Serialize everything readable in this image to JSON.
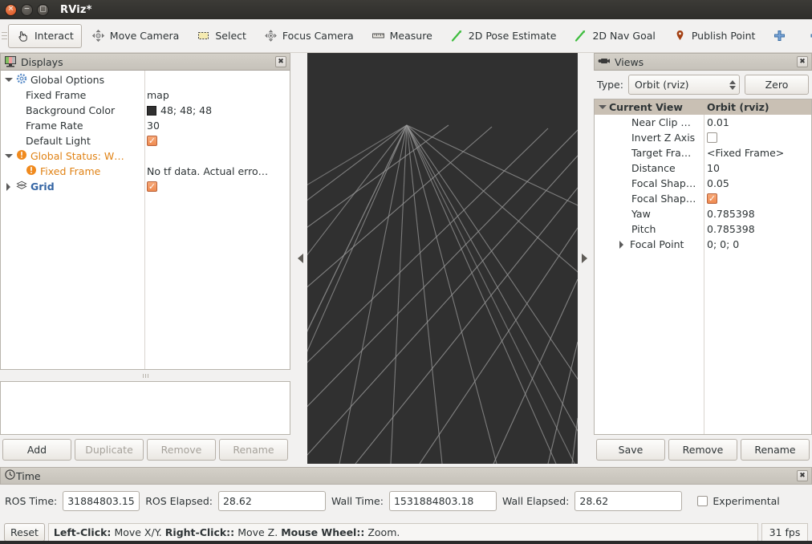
{
  "window": {
    "title": "RViz*",
    "buttons": {
      "close": "✕",
      "minimize": "−",
      "maximize": "□"
    }
  },
  "toolbar": {
    "items": [
      {
        "label": "Interact",
        "icon": "hand-cursor-icon",
        "checked": true
      },
      {
        "label": "Move Camera",
        "icon": "move-camera-icon",
        "checked": false
      },
      {
        "label": "Select",
        "icon": "select-rectangle-icon",
        "checked": false
      },
      {
        "label": "Focus Camera",
        "icon": "focus-camera-icon",
        "checked": false
      },
      {
        "label": "Measure",
        "icon": "ruler-icon",
        "checked": false
      },
      {
        "label": "2D Pose Estimate",
        "icon": "pose-arrow-icon",
        "checked": false
      },
      {
        "label": "2D Nav Goal",
        "icon": "nav-goal-arrow-icon",
        "checked": false
      },
      {
        "label": "Publish Point",
        "icon": "map-pin-icon",
        "checked": false
      },
      {
        "label": "",
        "icon": "plus-icon",
        "checked": false
      },
      {
        "label": "",
        "icon": "minus-icon",
        "checked": false
      }
    ]
  },
  "displays": {
    "title": "Displays",
    "icon": "displays-monitor-icon",
    "close_label": "✖",
    "rows": [
      {
        "name": "Global Options",
        "value": "",
        "indent": 0,
        "arrow": "down",
        "icon": "gear-icon",
        "style": "plain",
        "valueType": "none"
      },
      {
        "name": "Fixed Frame",
        "value": "map",
        "indent": 1,
        "arrow": "none",
        "icon": "",
        "style": "plain",
        "valueType": "text"
      },
      {
        "name": "Background Color",
        "value": "48; 48; 48",
        "indent": 1,
        "arrow": "none",
        "icon": "",
        "style": "plain",
        "valueType": "color",
        "swatch": "#303030"
      },
      {
        "name": "Frame Rate",
        "value": "30",
        "indent": 1,
        "arrow": "none",
        "icon": "",
        "style": "plain",
        "valueType": "text"
      },
      {
        "name": "Default Light",
        "value": "",
        "indent": 1,
        "arrow": "none",
        "icon": "",
        "style": "plain",
        "valueType": "checkbox-on"
      },
      {
        "name": "Global Status: W…",
        "value": "",
        "indent": 0,
        "arrow": "down",
        "icon": "warning-icon",
        "style": "warn",
        "valueType": "none"
      },
      {
        "name": "Fixed Frame",
        "value": "No tf data.  Actual erro…",
        "indent": 2,
        "arrow": "none",
        "icon": "warning-icon",
        "style": "warn",
        "valueType": "text"
      },
      {
        "name": "Grid",
        "value": "",
        "indent": 0,
        "arrow": "right",
        "icon": "grid-icon",
        "style": "blue",
        "valueType": "checkbox-on"
      }
    ],
    "buttons": [
      {
        "label": "Add",
        "enabled": true
      },
      {
        "label": "Duplicate",
        "enabled": false
      },
      {
        "label": "Remove",
        "enabled": false
      },
      {
        "label": "Rename",
        "enabled": false
      }
    ]
  },
  "views": {
    "title": "Views",
    "icon": "camera-icon",
    "close_label": "✖",
    "type_label": "Type:",
    "type_value": "Orbit (rviz)",
    "zero_label": "Zero",
    "header": {
      "name": "Current View",
      "value": "Orbit (rviz)"
    },
    "rows": [
      {
        "name": "Near Clip …",
        "value": "0.01",
        "valueType": "text",
        "arrow": "none"
      },
      {
        "name": "Invert Z Axis",
        "value": "",
        "valueType": "checkbox-off",
        "arrow": "none"
      },
      {
        "name": "Target Fra…",
        "value": "<Fixed Frame>",
        "valueType": "text",
        "arrow": "none"
      },
      {
        "name": "Distance",
        "value": "10",
        "valueType": "text",
        "arrow": "none"
      },
      {
        "name": "Focal Shap…",
        "value": "0.05",
        "valueType": "text",
        "arrow": "none"
      },
      {
        "name": "Focal Shap…",
        "value": "",
        "valueType": "checkbox-on",
        "arrow": "none"
      },
      {
        "name": "Yaw",
        "value": "0.785398",
        "valueType": "text",
        "arrow": "none"
      },
      {
        "name": "Pitch",
        "value": "0.785398",
        "valueType": "text",
        "arrow": "none"
      },
      {
        "name": "Focal Point",
        "value": "0; 0; 0",
        "valueType": "text",
        "arrow": "right"
      }
    ],
    "buttons": [
      {
        "label": "Save"
      },
      {
        "label": "Remove"
      },
      {
        "label": "Rename"
      }
    ]
  },
  "viewport": {
    "background_color": "#303030",
    "grid_color": "#9a9a9a",
    "collapse_left_icon": "collapse-left-arrow-icon",
    "collapse_right_icon": "collapse-right-arrow-icon"
  },
  "time": {
    "title": "Time",
    "icon": "clock-icon",
    "close_label": "✖",
    "fields": [
      {
        "label": "ROS Time:",
        "value": "31884803.15"
      },
      {
        "label": "ROS Elapsed:",
        "value": "28.62"
      },
      {
        "label": "Wall Time:",
        "value": "1531884803.18"
      },
      {
        "label": "Wall Elapsed:",
        "value": "28.62"
      }
    ],
    "experimental_label": "Experimental",
    "experimental_checked": false
  },
  "status": {
    "reset_label": "Reset",
    "hint": [
      {
        "text": "Left-Click:",
        "bold": true
      },
      {
        "text": "Move X/Y.",
        "bold": false
      },
      {
        "text": "Right-Click::",
        "bold": true
      },
      {
        "text": "Move Z.",
        "bold": false
      },
      {
        "text": "Mouse Wheel::",
        "bold": true
      },
      {
        "text": "Zoom.",
        "bold": false
      }
    ],
    "fps": "31 fps"
  }
}
